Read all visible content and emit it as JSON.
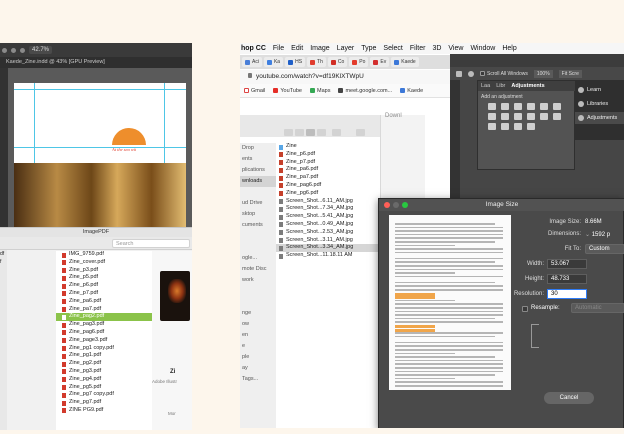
{
  "left": {
    "illustrator": {
      "zoom": "42.7%",
      "doc_tab": "Kaede_Zine.indd @ 43% [GPU Preview]",
      "art_caption": "At the sea wit"
    },
    "finder": {
      "title": "ImagePDF",
      "search_placeholder": "Search",
      "files": [
        "IMG_9759.pdf",
        "Zine_cover.pdf",
        "Zine_p3.pdf",
        "Zine_p5.pdf",
        "Zine_p6.pdf",
        "Zine_p7.pdf",
        "Zine_pa6.pdf",
        "Zine_pa7.pdf",
        "Zine_pag2.pdf",
        "Zine_pag3.pdf",
        "Zine_pag6.pdf",
        "Zine_page3.pdf",
        "Zine_pg1 copy.pdf",
        "Zine_pg1.pdf",
        "Zine_pg2.pdf",
        "Zine_pg3.pdf",
        "Zine_pg4.pdf",
        "Zine_pg5.pdf",
        "Zine_pg7 copy.pdf",
        "Zine_pg7.pdf",
        "ZINE PG9.pdf"
      ],
      "selected_index": 8,
      "left_col_markers": [
        "df",
        "f"
      ],
      "preview_name": "Zi",
      "preview_kind": "Adobe Illustr",
      "preview_more": "Mor"
    }
  },
  "right": {
    "menubar": {
      "app": "hop CC",
      "items": [
        "File",
        "Edit",
        "Image",
        "Layer",
        "Type",
        "Select",
        "Filter",
        "3D",
        "View",
        "Window",
        "Help"
      ]
    },
    "chrome": {
      "tabs": [
        {
          "label": "Aci",
          "color": "#4a7fd8"
        },
        {
          "label": "Ka",
          "color": "#3f7fe0"
        },
        {
          "label": "HS",
          "color": "#1f5fc8"
        },
        {
          "label": "Th",
          "color": "#e03c2e"
        },
        {
          "label": "Co",
          "color": "#d12d24"
        },
        {
          "label": "Po",
          "color": "#e33b2b"
        },
        {
          "label": "Ev",
          "color": "#d32f2f"
        },
        {
          "label": "Kaede",
          "color": "#3c78d8"
        }
      ],
      "url": "youtube.com/watch?v=df19KlXTWpU",
      "bookmarks": [
        {
          "label": "Gmail",
          "color": "#ffffff"
        },
        {
          "label": "YouTube",
          "color": "#e52d27"
        },
        {
          "label": "Maps",
          "color": "#34a853"
        },
        {
          "label": "meet.google.com...",
          "color": "#444444"
        },
        {
          "label": "Kaede",
          "color": "#3c78d8"
        }
      ]
    },
    "finder": {
      "path_hint": "Downl",
      "sidebar": [
        "Drop",
        "ents",
        "plications",
        "wnloads",
        "",
        "ud Drive",
        "sktop",
        "cuments",
        "",
        "",
        "ogle...",
        "mote Disc",
        "work",
        "",
        "",
        "nge",
        "ow",
        "en",
        "e",
        "ple",
        "ay",
        "Tags..."
      ],
      "sidebar_selected": 3,
      "files": [
        {
          "name": "Zine",
          "type": "folder"
        },
        {
          "name": "Zine_p6.pdf",
          "type": "pdf"
        },
        {
          "name": "Zine_p7.pdf",
          "type": "pdf"
        },
        {
          "name": "Zine_pa6.pdf",
          "type": "pdf"
        },
        {
          "name": "Zine_pa7.pdf",
          "type": "pdf"
        },
        {
          "name": "Zine_pag6.pdf",
          "type": "pdf"
        },
        {
          "name": "Zine_pg6.pdf",
          "type": "pdf"
        },
        {
          "name": "Screen_Shot...6.11_AM.jpg",
          "type": "jpg"
        },
        {
          "name": "Screen_Shot...7.34_AM.jpg",
          "type": "jpg"
        },
        {
          "name": "Screen_Shot...5.41_AM.jpg",
          "type": "jpg"
        },
        {
          "name": "Screen_Shot...0.49_AM.jpg",
          "type": "jpg"
        },
        {
          "name": "Screen_Shot...2.53_AM.jpg",
          "type": "jpg"
        },
        {
          "name": "Screen_Shot...3.11_AM.jpg",
          "type": "jpg"
        },
        {
          "name": "Screen_Shot...3.34_AM.jpg",
          "type": "jpg"
        },
        {
          "name": "Screen_Shot...11.18.11 AM",
          "type": "jpg"
        }
      ],
      "selected_index": 13
    },
    "photoshop": {
      "scroll_all_label": "Scroll All Windows",
      "zoom": "100%",
      "fit_screen": "Fit Scre",
      "panel_tabs": [
        "Laa",
        "Libr",
        "Adjustments"
      ],
      "active_panel_tab": "Adjustments",
      "add_adjustment": "Add an adjustment",
      "side_items": [
        "Learn",
        "Libraries",
        "Adjustments"
      ],
      "side_selected": 2
    },
    "image_size": {
      "title": "Image Size",
      "image_size_label": "Image Size:",
      "image_size_value": "8.66M",
      "dimensions_label": "Dimensions:",
      "dimensions_value": "1592 p",
      "fit_to_label": "Fit To:",
      "fit_to_value": "Custom",
      "width_label": "Width:",
      "width_value": "53.067",
      "height_label": "Height:",
      "height_value": "48.733",
      "resolution_label": "Resolution:",
      "resolution_value": "30",
      "resample_label": "Resample:",
      "resample_value": "Automatic",
      "cancel_label": "Cancel"
    }
  }
}
